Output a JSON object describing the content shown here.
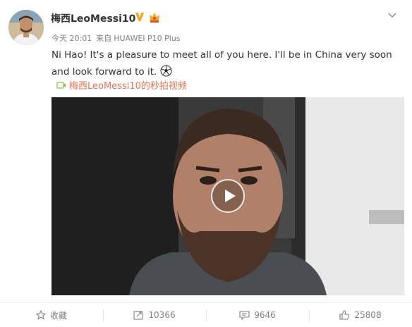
{
  "post": {
    "username": "梅西LeoMessi10",
    "time": "今天 20:01",
    "source_prefix": "来自",
    "source_device": "HUAWEI P10 Plus",
    "text": "Ni Hao! It's a pleasure to meet all of you here. I'll be in China very soon and look forward to it.",
    "video_link": "梅西LeoMessi10的秒拍视频"
  },
  "footer": {
    "favorite_label": "收藏",
    "repost_count": "10366",
    "comment_count": "9646",
    "like_count": "25808"
  },
  "colors": {
    "link": "#eb7350",
    "verified": "#f5a623",
    "meta": "#808080"
  },
  "icons": [
    "avatar",
    "verified-icon",
    "crown-icon",
    "chevron-down-icon",
    "soccer-ball-icon",
    "video-link-icon",
    "play-icon",
    "star-icon",
    "repost-icon",
    "comment-icon",
    "like-icon"
  ]
}
